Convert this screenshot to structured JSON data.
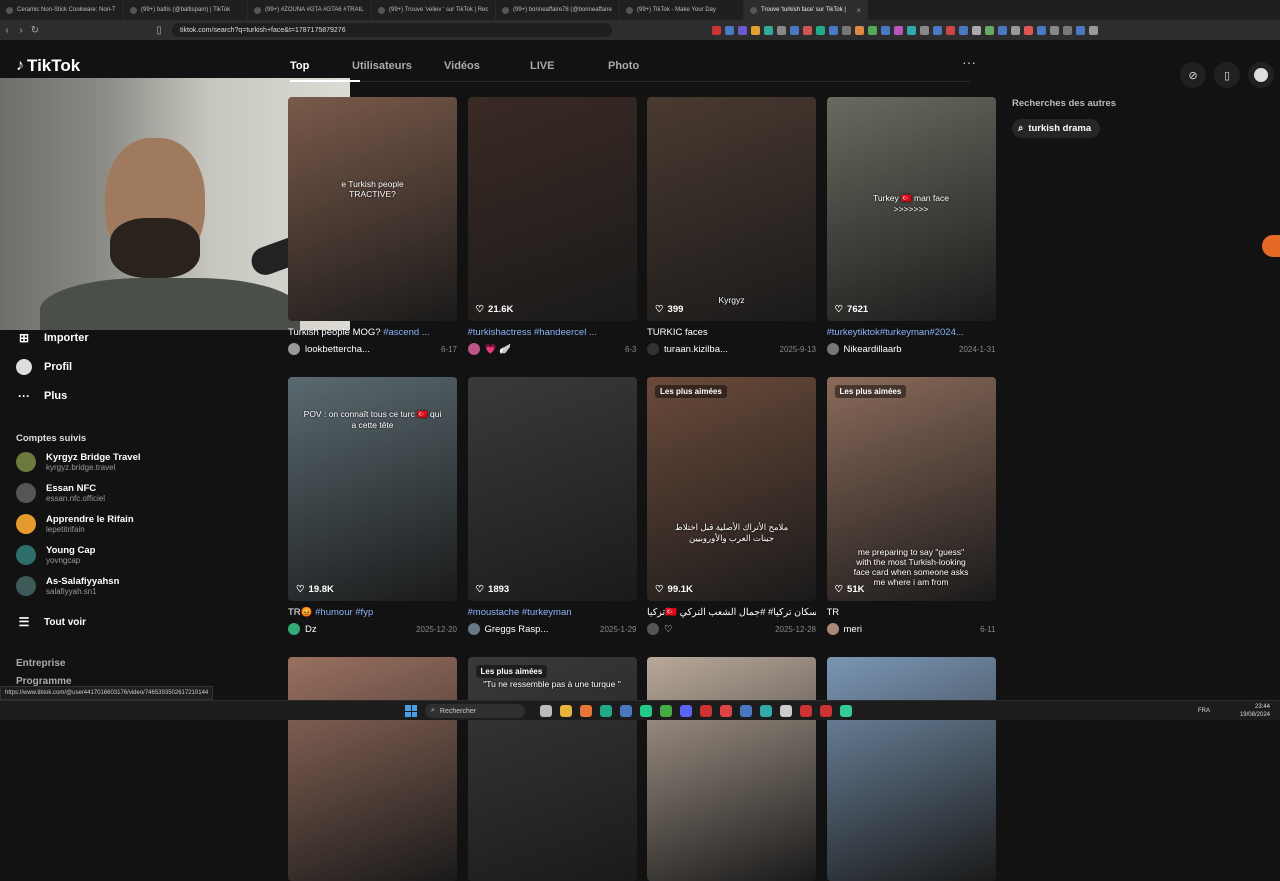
{
  "browser": {
    "tabs": [
      {
        "label": "Ceramic Non-Stick Cookware: Non-T",
        "active": false
      },
      {
        "label": "(99+) baltis (@baltispam) | TikTok",
        "active": false
      },
      {
        "label": "(99+) #ZOUNA #GTA #GTA6 #TRAIL",
        "active": false
      },
      {
        "label": "(99+) Trouve 'veliev ' sur TikTok | Rec",
        "active": false
      },
      {
        "label": "(99+) bonneaffaire78 (@bonneaffaire",
        "active": false
      },
      {
        "label": "(99+) TikTok - Make Your Day",
        "active": false
      },
      {
        "label": "Trouve 'turkish face' sur TikTok |",
        "active": true
      }
    ],
    "url": "tiktok.com/search?q=turkish+face&t=1787175879276"
  },
  "tiktok": {
    "logo": "TikTok",
    "search_tabs": [
      "Top",
      "Utilisateurs",
      "Vidéos",
      "LIVE",
      "Photo"
    ],
    "more_label": "···",
    "sidebar": {
      "import": "Importer",
      "profile": "Profil",
      "more": "Plus",
      "followed_title": "Comptes suivis",
      "followed": [
        {
          "name": "Kyrgyz Bridge Travel",
          "handle": "kyrgyz.bridge.travel",
          "color": "#6b7a3e"
        },
        {
          "name": "Essan NFC",
          "handle": "essan.nfc.officiel",
          "color": "#555555"
        },
        {
          "name": "Apprendre le Rifain",
          "handle": "lepetitrifain",
          "color": "#e59a2e"
        },
        {
          "name": "Young Cap",
          "handle": "yovngcap",
          "color": "#2d6e6a"
        },
        {
          "name": "As-Salafiyyahsn",
          "handle": "salafiyyah.sn1",
          "color": "#3d5a58"
        }
      ],
      "see_all": "Tout voir",
      "footer": [
        "Entreprise",
        "Programme"
      ]
    },
    "right_panel": {
      "title": "Recherches des autres",
      "chip": "turkish drama"
    },
    "cards": [
      {
        "likes": "",
        "desc_plain": "Turkish people MOG? ",
        "desc_tags": "#ascend ...",
        "author": "lookbettercha...",
        "date": "6-17",
        "bg": "#7a5a4a",
        "overlay": "e Turkish people\nTRACTIVE?",
        "badge": "",
        "avatar": "#999"
      },
      {
        "likes": "21.6K",
        "desc_plain": "",
        "desc_tags": "#turkishactress #handeercel ...",
        "author": "💗 🪽",
        "date": "6-3",
        "bg": "#3a2a24",
        "overlay": "",
        "badge": "",
        "avatar": "#b58"
      },
      {
        "likes": "399",
        "desc_plain": "TURKIC faces",
        "desc_tags": "",
        "author": "turaan.kizilba...",
        "date": "2025-9-13",
        "bg": "#4a3a30",
        "overlay": "Kyrgyz",
        "badge": "",
        "avatar": "#333"
      },
      {
        "likes": "7621",
        "desc_plain": "",
        "desc_tags": "#turkeytiktok#turkeyman#2024...",
        "author": "Nikeardillaarb",
        "date": "2024-1-31",
        "bg": "#6a6a60",
        "overlay": "Turkey 🇹🇷 man face\n>>>>>>>",
        "badge": "",
        "avatar": "#777"
      },
      {
        "likes": "19.8K",
        "desc_plain": "TR😡 ",
        "desc_tags": "#humour #fyp",
        "author": "Dz",
        "date": "2025-12-20",
        "bg": "#5a6a70",
        "overlay": "POV : on connaît tous ce turc 🇹🇷 qui\na cette tête",
        "badge": "",
        "avatar": "#3a7"
      },
      {
        "likes": "1893",
        "desc_plain": "",
        "desc_tags": "#moustache #turkeyman",
        "author": "Greggs Rasp...",
        "date": "2025-1-29",
        "bg": "#3a3a3c",
        "overlay": "",
        "badge": "",
        "avatar": "#678"
      },
      {
        "likes": "99.1K",
        "desc_plain": "تركيا🇹🇷 سكان تركيا# #جمال الشعب التركي🤍 ...",
        "desc_tags": "",
        "author": "♡",
        "date": "2025-12-28",
        "bg": "#6a4a3a",
        "overlay": "ملامح الأتراك الأصلية قبل اختلاط\nجينات العرب والأوروبيين",
        "badge": "Les plus aimées",
        "avatar": "#555"
      },
      {
        "likes": "51K",
        "desc_plain": "TR",
        "desc_tags": "",
        "author": "meri",
        "date": "6-11",
        "bg": "#8a6a5a",
        "overlay": "me preparing to say \"guess\"\nwith the most Turkish-looking\nface card when someone asks\nme where i am from",
        "badge": "Les plus aimées",
        "avatar": "#a87"
      },
      {
        "likes": "",
        "desc_plain": "",
        "desc_tags": "",
        "author": "",
        "date": "",
        "bg": "#9a7060",
        "overlay": "",
        "badge": "",
        "avatar": "#000"
      },
      {
        "likes": "",
        "desc_plain": "",
        "desc_tags": "",
        "author": "",
        "date": "",
        "bg": "#3a3a3a",
        "overlay": "\"Tu ne ressemble pas à une turque \"",
        "badge": "Les plus aimées",
        "avatar": "#000"
      },
      {
        "likes": "",
        "desc_plain": "",
        "desc_tags": "",
        "author": "",
        "date": "",
        "bg": "#b8a89a",
        "overlay": "",
        "badge": "",
        "avatar": "#000"
      },
      {
        "likes": "",
        "desc_plain": "",
        "desc_tags": "",
        "author": "",
        "date": "",
        "bg": "#7a96b4",
        "overlay": "",
        "badge": "",
        "avatar": "#000"
      }
    ]
  },
  "status_url": "https://www.tiktok.com/@user4417016603176/video/7465393502617210144",
  "taskbar": {
    "search": "Rechercher",
    "lang": "FRA",
    "time": "23:44",
    "date": "19/08/2024"
  }
}
